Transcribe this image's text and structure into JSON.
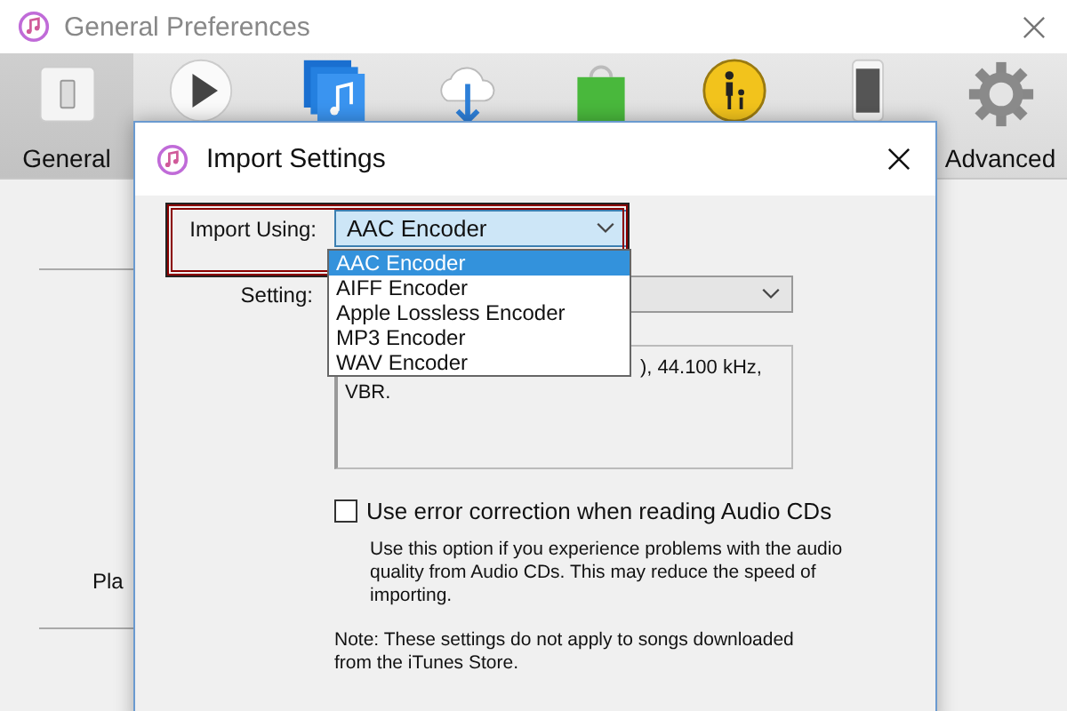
{
  "window": {
    "title": "General Preferences"
  },
  "toolbar": [
    {
      "kind": "general",
      "label": "General",
      "selected": true
    },
    {
      "kind": "playback",
      "selected": false
    },
    {
      "kind": "sharing",
      "selected": false
    },
    {
      "kind": "download",
      "selected": false
    },
    {
      "kind": "store",
      "selected": false
    },
    {
      "kind": "restrictions",
      "selected": false
    },
    {
      "kind": "devices",
      "selected": false
    },
    {
      "kind": "advanced",
      "label": "Advanced",
      "selected": false
    }
  ],
  "background_label": "Pla",
  "dialog": {
    "title": "Import Settings",
    "import_using": {
      "label": "Import Using:",
      "value": "AAC Encoder",
      "options": [
        {
          "label": "AAC Encoder",
          "selected": true
        },
        {
          "label": "AIFF Encoder",
          "selected": false
        },
        {
          "label": "Apple Lossless Encoder",
          "selected": false
        },
        {
          "label": "MP3 Encoder",
          "selected": false
        },
        {
          "label": "WAV Encoder",
          "selected": false
        }
      ]
    },
    "setting": {
      "label": "Setting:"
    },
    "details": [
      "), 44.100 kHz,",
      "VBR."
    ],
    "error_correction": {
      "label": "Use error correction when reading Audio CDs",
      "checked": false,
      "help": "Use this option if you experience problems with the audio quality from Audio CDs.  This may reduce the speed of importing."
    },
    "note": "Note: These settings do not apply to songs downloaded from the iTunes Store."
  }
}
